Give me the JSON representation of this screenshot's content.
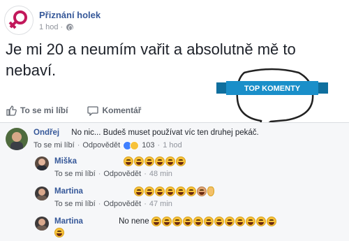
{
  "post": {
    "page_name": "Přiznání holek",
    "time": "1 hod",
    "dot": "·",
    "text": "Je mi 20 a neumím vařit a absolutně mě to nebaví."
  },
  "badge": {
    "label": "TOP KOMENTY",
    "color": "#1a8fc9"
  },
  "actions": {
    "like": "To se mi líbí",
    "comment": "Komentář"
  },
  "comments": [
    {
      "author": "Ondřej",
      "text": "No nic... Budeš muset používat víc ten druhej pekáč.",
      "like": "To se mi líbí",
      "reply": "Odpovědět",
      "reactions": "103",
      "time": "1 hod"
    },
    {
      "author": "Miška",
      "emoji_count": 6,
      "like": "To se mi líbí",
      "reply": "Odpovědět",
      "time": "48 min"
    },
    {
      "author": "Martina",
      "emoji_count": 6,
      "like": "To se mi líbí",
      "reply": "Odpovědět",
      "time": "47 min"
    },
    {
      "author": "Martina",
      "text": "No nene",
      "emoji_count": 13
    }
  ],
  "colors": {
    "link": "#365899",
    "muted": "#90949c",
    "brand_pink": "#c2185b"
  }
}
